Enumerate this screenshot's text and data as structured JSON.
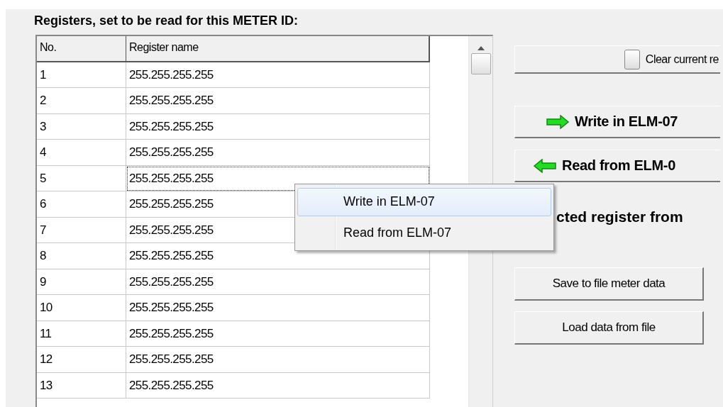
{
  "heading": "Registers, set to be read for this METER ID:",
  "table": {
    "columns": [
      "No.",
      "Register name"
    ],
    "rows": [
      {
        "no": "1",
        "name": "255.255.255.255",
        "focused": false
      },
      {
        "no": "2",
        "name": "255.255.255.255",
        "focused": false
      },
      {
        "no": "3",
        "name": "255.255.255.255",
        "focused": false
      },
      {
        "no": "4",
        "name": "255.255.255.255",
        "focused": false
      },
      {
        "no": "5",
        "name": "255.255.255.255",
        "focused": true
      },
      {
        "no": "6",
        "name": "255.255.255.255",
        "focused": false
      },
      {
        "no": "7",
        "name": "255.255.255.255",
        "focused": false
      },
      {
        "no": "8",
        "name": "255.255.255.255",
        "focused": false
      },
      {
        "no": "9",
        "name": "255.255.255.255",
        "focused": false
      },
      {
        "no": "10",
        "name": "255.255.255.255",
        "focused": false
      },
      {
        "no": "11",
        "name": "255.255.255.255",
        "focused": false
      },
      {
        "no": "12",
        "name": "255.255.255.255",
        "focused": false
      },
      {
        "no": "13",
        "name": "255.255.255.255",
        "focused": false
      }
    ]
  },
  "clear_button": {
    "label": "Clear current re",
    "checked": false
  },
  "write_button": {
    "label": "Write in ELM-07"
  },
  "read_button": {
    "label": "Read from ELM-0"
  },
  "partial_label": "cted register from",
  "save_button": {
    "label": "Save to file meter data"
  },
  "load_button": {
    "label": "Load data from file"
  },
  "context_menu": [
    {
      "label": "Write in ELM-07",
      "selected": true
    },
    {
      "label": "Read from ELM-07",
      "selected": false
    }
  ]
}
